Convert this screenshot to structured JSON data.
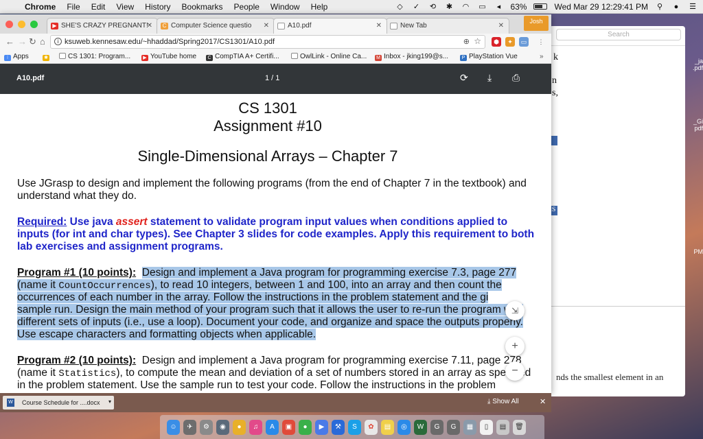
{
  "menubar": {
    "app": "Chrome",
    "menus": [
      "File",
      "Edit",
      "View",
      "History",
      "Bookmarks",
      "People",
      "Window",
      "Help"
    ],
    "battery": "63%",
    "datetime": "Wed Mar 29  12:29:41 PM"
  },
  "tabs": [
    {
      "label": "SHE'S CRAZY PREGNANT!",
      "color": "#e52d27"
    },
    {
      "label": "Computer Science questio",
      "color": "#f0a03b"
    },
    {
      "label": "A10.pdf",
      "color": "#ffffff"
    },
    {
      "label": "New Tab",
      "color": "#ffffff"
    }
  ],
  "profile_name": "Josh",
  "url": "ksuweb.kennesaw.edu/~hhaddad/Spring2017/CS1301/A10.pdf",
  "bookmarks": [
    "Apps",
    "CS 1301: Program...",
    "YouTube home",
    "CompTIA A+ Certifi...",
    "OwlLink - Online Ca...",
    "Inbox - jking199@s...",
    "PlayStation Vue"
  ],
  "pdf": {
    "filename": "A10.pdf",
    "pages": "1 / 1",
    "doc": {
      "course": "CS 1301",
      "assignment": "Assignment #10",
      "subtitle": "Single-Dimensional Arrays – Chapter 7",
      "intro1": "Use JGrasp to design and implement the following programs (from the end of Chapter 7 in the textbook) and",
      "intro2": "understand what they do.",
      "req_label": "Required:",
      "req_a": " Use java ",
      "req_assert": "assert",
      "req_b": " statement to validate program input values when conditions applied to",
      "req_2": "inputs (for int and char types). See Chapter 3 slides for code examples. Apply this requirement to both",
      "req_3": "lab exercises and assignment programs.",
      "p1_label": "Program #1 (10 points):",
      "p1_l1": "Design and implement a Java program for programming exercise 7.3, page 277",
      "p1_l2a": "(name it ",
      "p1_code": "CountOccurrences",
      "p1_l2b": "), to read 10 integers, between 1 and 100, into an array and then count the",
      "p1_l3": "occurrences of each number in the array. Follow the instructions in the problem statement and the gi",
      "p1_l4": "sample run. Design the main method of your program such that it allows the user to re-run the program with",
      "p1_l5": "different sets of inputs (i.e., use a loop). Document your code, and organize and space the outputs properly.",
      "p1_l6": "Use escape characters and formatting objects when applicable.",
      "p2_label": "Program #2 (10 points):",
      "p2_l1": "Design and implement a Java program for programming exercise 7.11, page 278",
      "p2_l2a": "(name it ",
      "p2_code": "Statistics",
      "p2_l2b": "), to compute the mean and deviation of a set of numbers stored in an array as specified",
      "p2_l3": "in the problem statement.  Use the sample run to test your code.  Follow the instructions in the problem"
    }
  },
  "downloads": {
    "item": "Course Schedule for ....docx",
    "show_all": "Show All"
  },
  "background_window": {
    "search_placeholder": "Search",
    "snippets": [
      "k",
      "n",
      "s,",
      "is"
    ],
    "paragraph": "nds the smallest element in an"
  },
  "desktop_icons": [
    "_ja .pdf",
    "_Gi pdf",
    "PM"
  ]
}
